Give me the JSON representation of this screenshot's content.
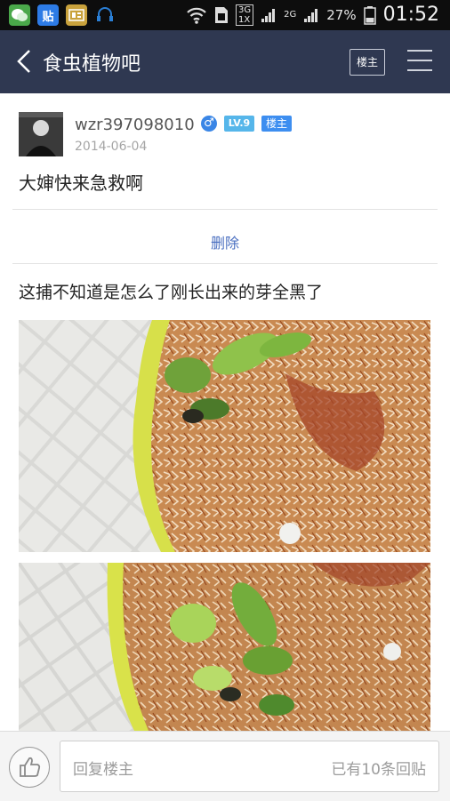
{
  "status_bar": {
    "apps": [
      {
        "icon": "wechat-icon",
        "color": "#4aa84a"
      },
      {
        "icon": "tieba-icon",
        "label": "贴",
        "color": "#2d7be5"
      },
      {
        "icon": "news-icon",
        "color": "#c9a23c"
      },
      {
        "icon": "headset-icon",
        "color": "#2a7fd6"
      }
    ],
    "network_top": "3G",
    "network_bottom": "1X",
    "network2": "2G",
    "battery": "27%",
    "time": "01:52"
  },
  "header": {
    "title": "食虫植物吧",
    "louzhu_button": "楼主"
  },
  "post": {
    "username": "wzr397098010",
    "gender_symbol": "♂",
    "level": "LV.9",
    "role_badge": "楼主",
    "date": "2014-06-04",
    "title": "大婶快来急救啊",
    "delete_label": "删除",
    "body": "这捕不知道是怎么了刚长出来的芽全黑了"
  },
  "reply_bar": {
    "placeholder": "回复楼主",
    "count_text": "已有10条回贴"
  },
  "colors": {
    "header_bg": "#2f3851",
    "link_blue": "#4a6fc0",
    "badge_blue": "#3d8ef0",
    "level_blue": "#56b6ea"
  }
}
